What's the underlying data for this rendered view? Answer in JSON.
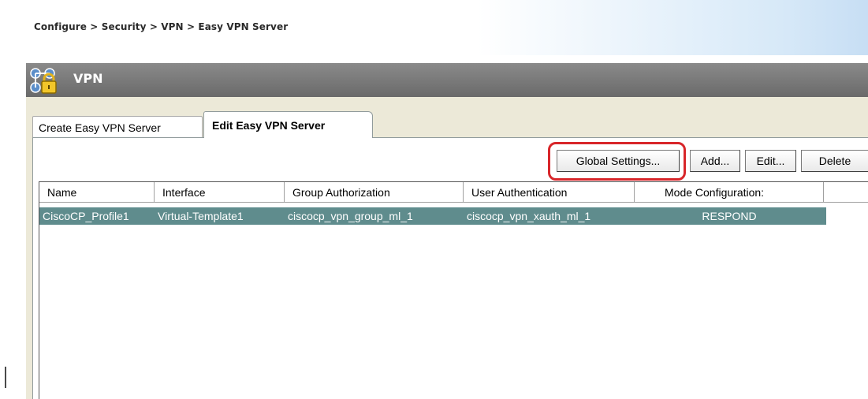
{
  "breadcrumb": "Configure > Security > VPN > Easy VPN Server",
  "header": {
    "title": "VPN",
    "icon": "vpn-lock-icon"
  },
  "tabs": [
    {
      "label": "Create Easy VPN Server",
      "active": false
    },
    {
      "label": "Edit Easy VPN Server",
      "active": true
    }
  ],
  "toolbar": {
    "global_settings_label": "Global Settings...",
    "add_label": "Add...",
    "edit_label": "Edit...",
    "delete_label": "Delete"
  },
  "table": {
    "columns": [
      "Name",
      "Interface",
      "Group Authorization",
      "User Authentication",
      "Mode Configuration:"
    ],
    "rows": [
      {
        "name": "CiscoCP_Profile1",
        "interface": "Virtual-Template1",
        "group_authorization": "ciscocp_vpn_group_ml_1",
        "user_authentication": "ciscocp_vpn_xauth_ml_1",
        "mode_configuration": "RESPOND",
        "selected": true
      }
    ]
  },
  "colors": {
    "highlight": "#d8262a",
    "selected_row": "#5f8c8d",
    "header_bar": "#7a7a7a"
  }
}
